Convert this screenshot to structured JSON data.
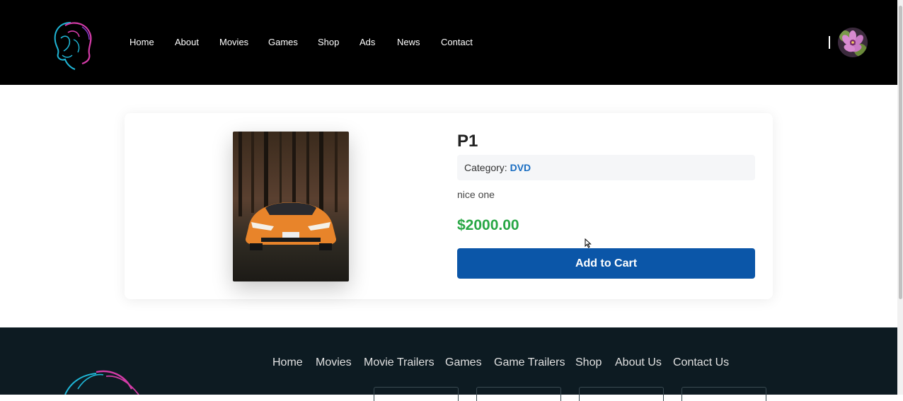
{
  "header": {
    "nav": [
      {
        "label": "Home"
      },
      {
        "label": "About"
      },
      {
        "label": "Movies"
      },
      {
        "label": "Games"
      },
      {
        "label": "Shop"
      },
      {
        "label": "Ads"
      },
      {
        "label": "News"
      },
      {
        "label": "Contact"
      }
    ]
  },
  "product": {
    "title": "P1",
    "category_label": "Category:",
    "category_value": "DVD",
    "description": "nice one",
    "price": "$2000.00",
    "add_to_cart_label": "Add to Cart"
  },
  "footer": {
    "nav": [
      {
        "label": "Home"
      },
      {
        "label": "Movies"
      },
      {
        "label": "Movie Trailers"
      },
      {
        "label": "Games"
      },
      {
        "label": "Game Trailers"
      },
      {
        "label": "Shop"
      },
      {
        "label": "About Us"
      },
      {
        "label": "Contact Us"
      }
    ]
  },
  "colors": {
    "header_bg": "#000000",
    "accent_button": "#0b56a8",
    "price": "#28a745",
    "category_link": "#1b6ec2",
    "footer_bg": "#0d1b22"
  },
  "icons": {
    "logo": "neon-face-logo-icon",
    "avatar": "flower-avatar",
    "cursor": "mouse-pointer-icon"
  }
}
